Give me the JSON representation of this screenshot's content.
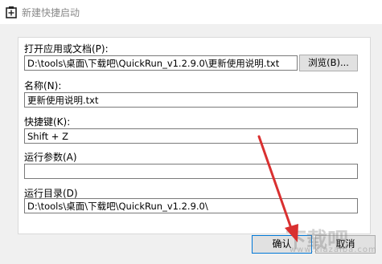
{
  "window": {
    "title": "新建快捷启动"
  },
  "fields": {
    "file": {
      "label": "打开应用或文档(P):",
      "value": "D:\\tools\\桌面\\下载吧\\QuickRun_v1.2.9.0\\更新使用说明.txt"
    },
    "name": {
      "label": "名称(N):",
      "value": "更新使用说明.txt"
    },
    "hotkey": {
      "label": "快捷键(K):",
      "value": "Shift + Z"
    },
    "args": {
      "label": "运行参数(A)",
      "value": ""
    },
    "workdir": {
      "label": "运行目录(D)",
      "value": "D:\\tools\\桌面\\下载吧\\QuickRun_v1.2.9.0\\"
    }
  },
  "buttons": {
    "browse": "浏览(B)...",
    "ok": "确认",
    "cancel": "取消"
  },
  "watermark": {
    "text": "下载吧",
    "url": "www.xiazaiba.com"
  },
  "colors": {
    "accent": "#0078d7",
    "arrow": "#d93030"
  }
}
